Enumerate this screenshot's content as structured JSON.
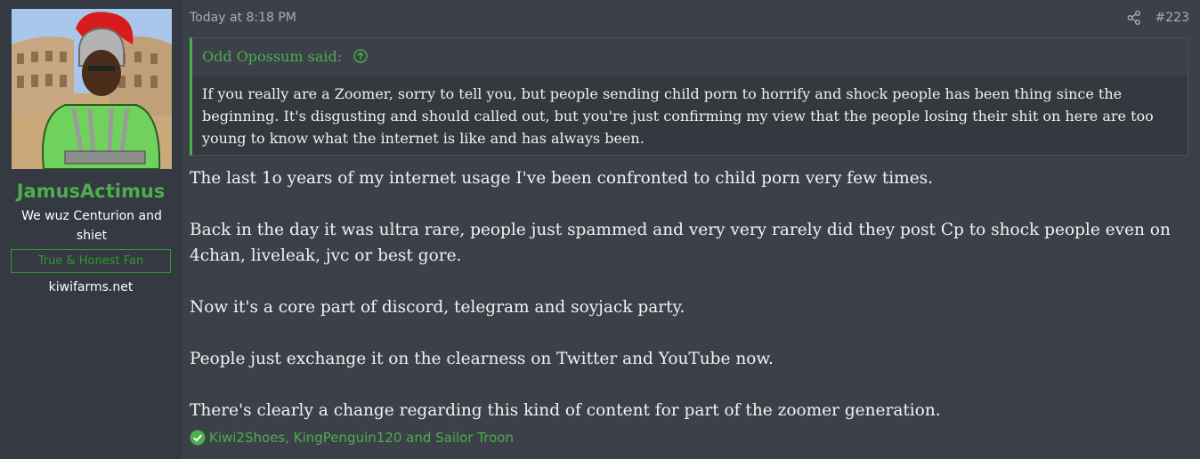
{
  "user": {
    "name": "JamusActimus",
    "title": "We wuz Centurion and shiet",
    "banner": "True & Honest Fan",
    "site": "kiwifarms.net"
  },
  "post": {
    "timestamp": "Today at 8:18 PM",
    "number": "#223",
    "share_icon": "share-icon"
  },
  "quote": {
    "attribution": "Odd Opossum said:",
    "text": "If you really are a Zoomer, sorry to tell you, but people sending child porn to horrify and shock people has been thing since the beginning. It's disgusting and should called out, but you're just confirming my view that the people losing their shit on here are too young to know what the internet is like and has always been."
  },
  "message": {
    "paragraphs": [
      "The last 1o years of my internet usage I've been confronted to child porn very few times.",
      "Back in the day it was ultra rare, people just spammed and very very rarely did they post Cp to shock people even on 4chan, liveleak, jvc or best gore.",
      "Now it's a core part of discord, telegram and soyjack party.",
      "People just exchange it on the clearness on Twitter and YouTube now.",
      "There's clearly a change regarding this kind of content for part of the zoomer generation."
    ]
  },
  "reactions": {
    "users": "Kiwi2Shoes, KingPenguin120 and Sailor Troon"
  },
  "colors": {
    "accent": "#4cae4c",
    "background": "#3c4049",
    "sidebar": "#353941"
  }
}
